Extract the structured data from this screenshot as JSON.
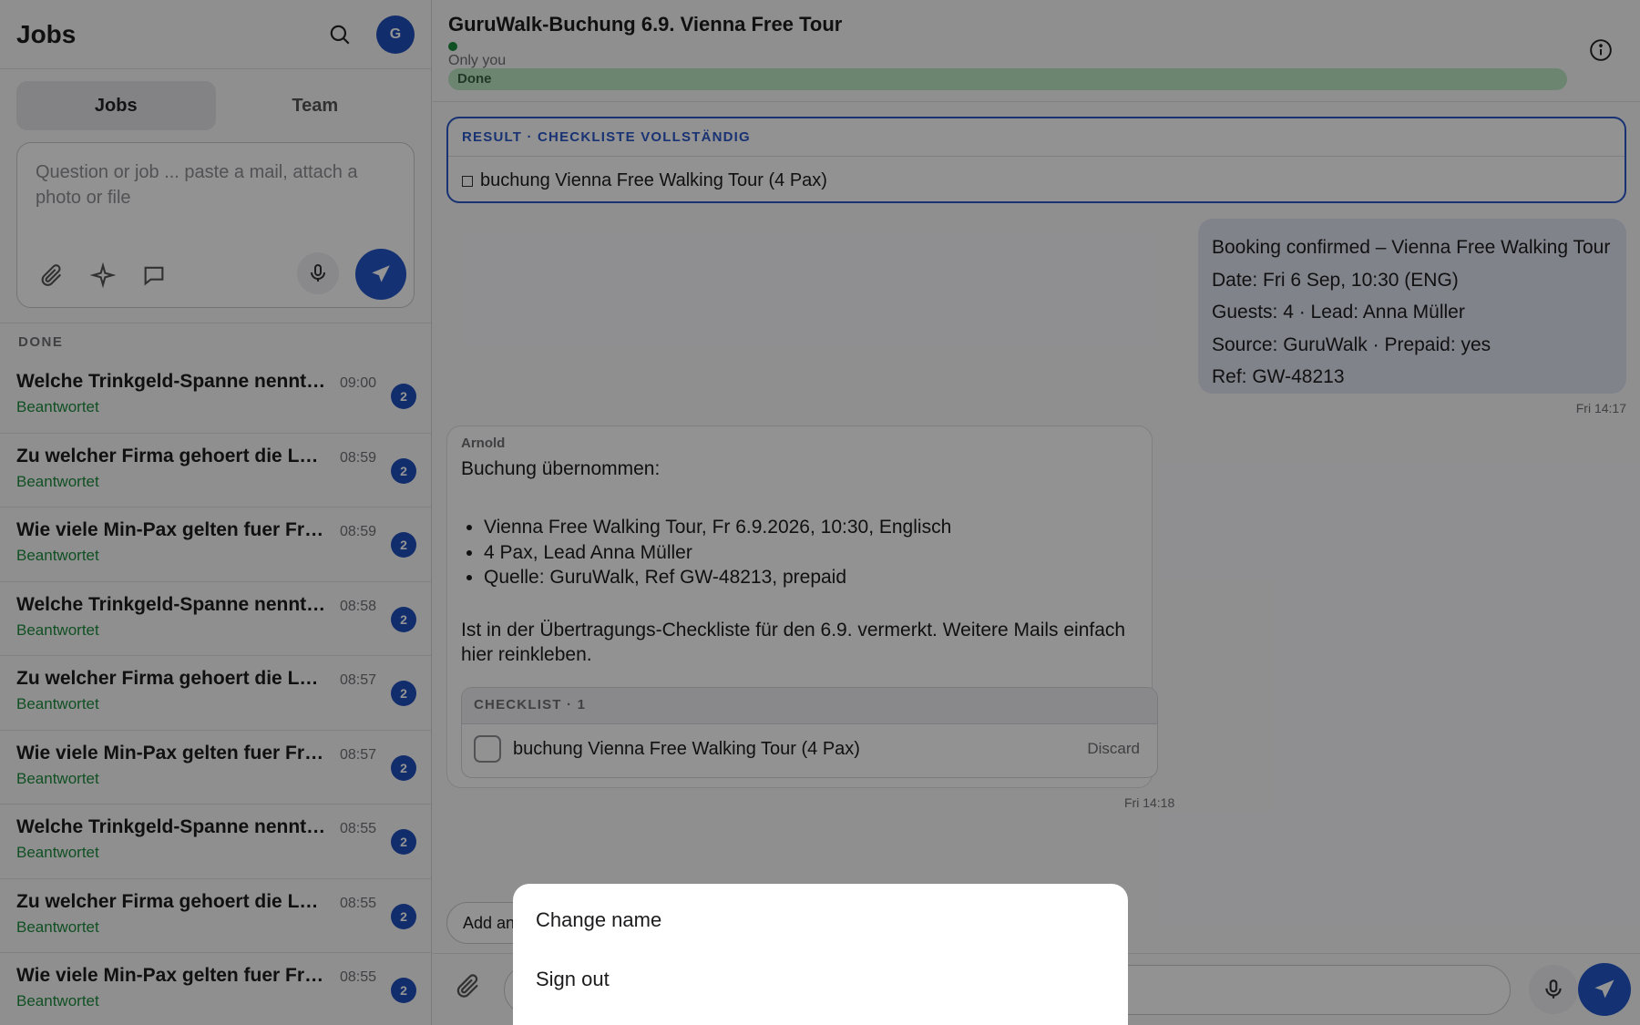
{
  "sidebar": {
    "title": "Jobs",
    "avatar_initial": "G",
    "tabs": [
      {
        "label": "Jobs",
        "active": true
      },
      {
        "label": "Team",
        "active": false
      }
    ],
    "composer_placeholder": "Question or job ... paste a mail, attach a photo or file",
    "section_label": "DONE",
    "jobs": [
      {
        "title": "Welche Trinkgeld-Spanne nennt ...",
        "status": "Beantwortet",
        "time": "09:00",
        "count": "2"
      },
      {
        "title": "Zu welcher Firma gehoert die Lea...",
        "status": "Beantwortet",
        "time": "08:59",
        "count": "2"
      },
      {
        "title": "Wie viele Min-Pax gelten fuer Fre...",
        "status": "Beantwortet",
        "time": "08:59",
        "count": "2"
      },
      {
        "title": "Welche Trinkgeld-Spanne nennt ...",
        "status": "Beantwortet",
        "time": "08:58",
        "count": "2"
      },
      {
        "title": "Zu welcher Firma gehoert die Lea...",
        "status": "Beantwortet",
        "time": "08:57",
        "count": "2"
      },
      {
        "title": "Wie viele Min-Pax gelten fuer Fre...",
        "status": "Beantwortet",
        "time": "08:57",
        "count": "2"
      },
      {
        "title": "Welche Trinkgeld-Spanne nennt ...",
        "status": "Beantwortet",
        "time": "08:55",
        "count": "2"
      },
      {
        "title": "Zu welcher Firma gehoert die Lea...",
        "status": "Beantwortet",
        "time": "08:55",
        "count": "2"
      },
      {
        "title": "Wie viele Min-Pax gelten fuer Fre...",
        "status": "Beantwortet",
        "time": "08:55",
        "count": "2"
      }
    ]
  },
  "main": {
    "title": "GuruWalk-Buchung 6.9. Vienna Free Tour",
    "visibility": "Only you",
    "status": "Done",
    "result": {
      "header": "RESULT · CHECKLISTE VOLLSTÄNDIG",
      "item": "buchung Vienna Free Walking Tour (4 Pax)"
    },
    "user_message": {
      "lines": [
        "Booking confirmed – Vienna Free Walking Tour",
        "Date: Fri 6 Sep, 10:30 (ENG)",
        "Guests: 4 · Lead: Anna Müller",
        "Source: GuruWalk · Prepaid: yes",
        "Ref: GW-48213"
      ],
      "time": "Fri 14:17"
    },
    "assistant_message": {
      "sender": "Arnold",
      "intro": "Buchung übernommen:",
      "bullets": [
        "Vienna Free Walking Tour, Fr 6.9.2026, 10:30, Englisch",
        "4 Pax, Lead Anna Müller",
        "Quelle: GuruWalk, Ref GW-48213, prepaid"
      ],
      "paragraph": "Ist in der Übertragungs-Checkliste für den 6.9. vermerkt. Weitere Mails einfach hier reinkleben.",
      "checklist_header": "CHECKLIST · 1",
      "checklist_item": "buchung Vienna Free Walking Tour (4 Pax)",
      "discard_label": "Discard",
      "time": "Fri 14:18"
    },
    "note_pill": "Add an"
  },
  "menu": {
    "items": [
      "Change name",
      "Sign out"
    ]
  },
  "colors": {
    "accent": "#1f4fb8",
    "success": "#1d8a3c",
    "status_bar": "#b9e6c2"
  }
}
